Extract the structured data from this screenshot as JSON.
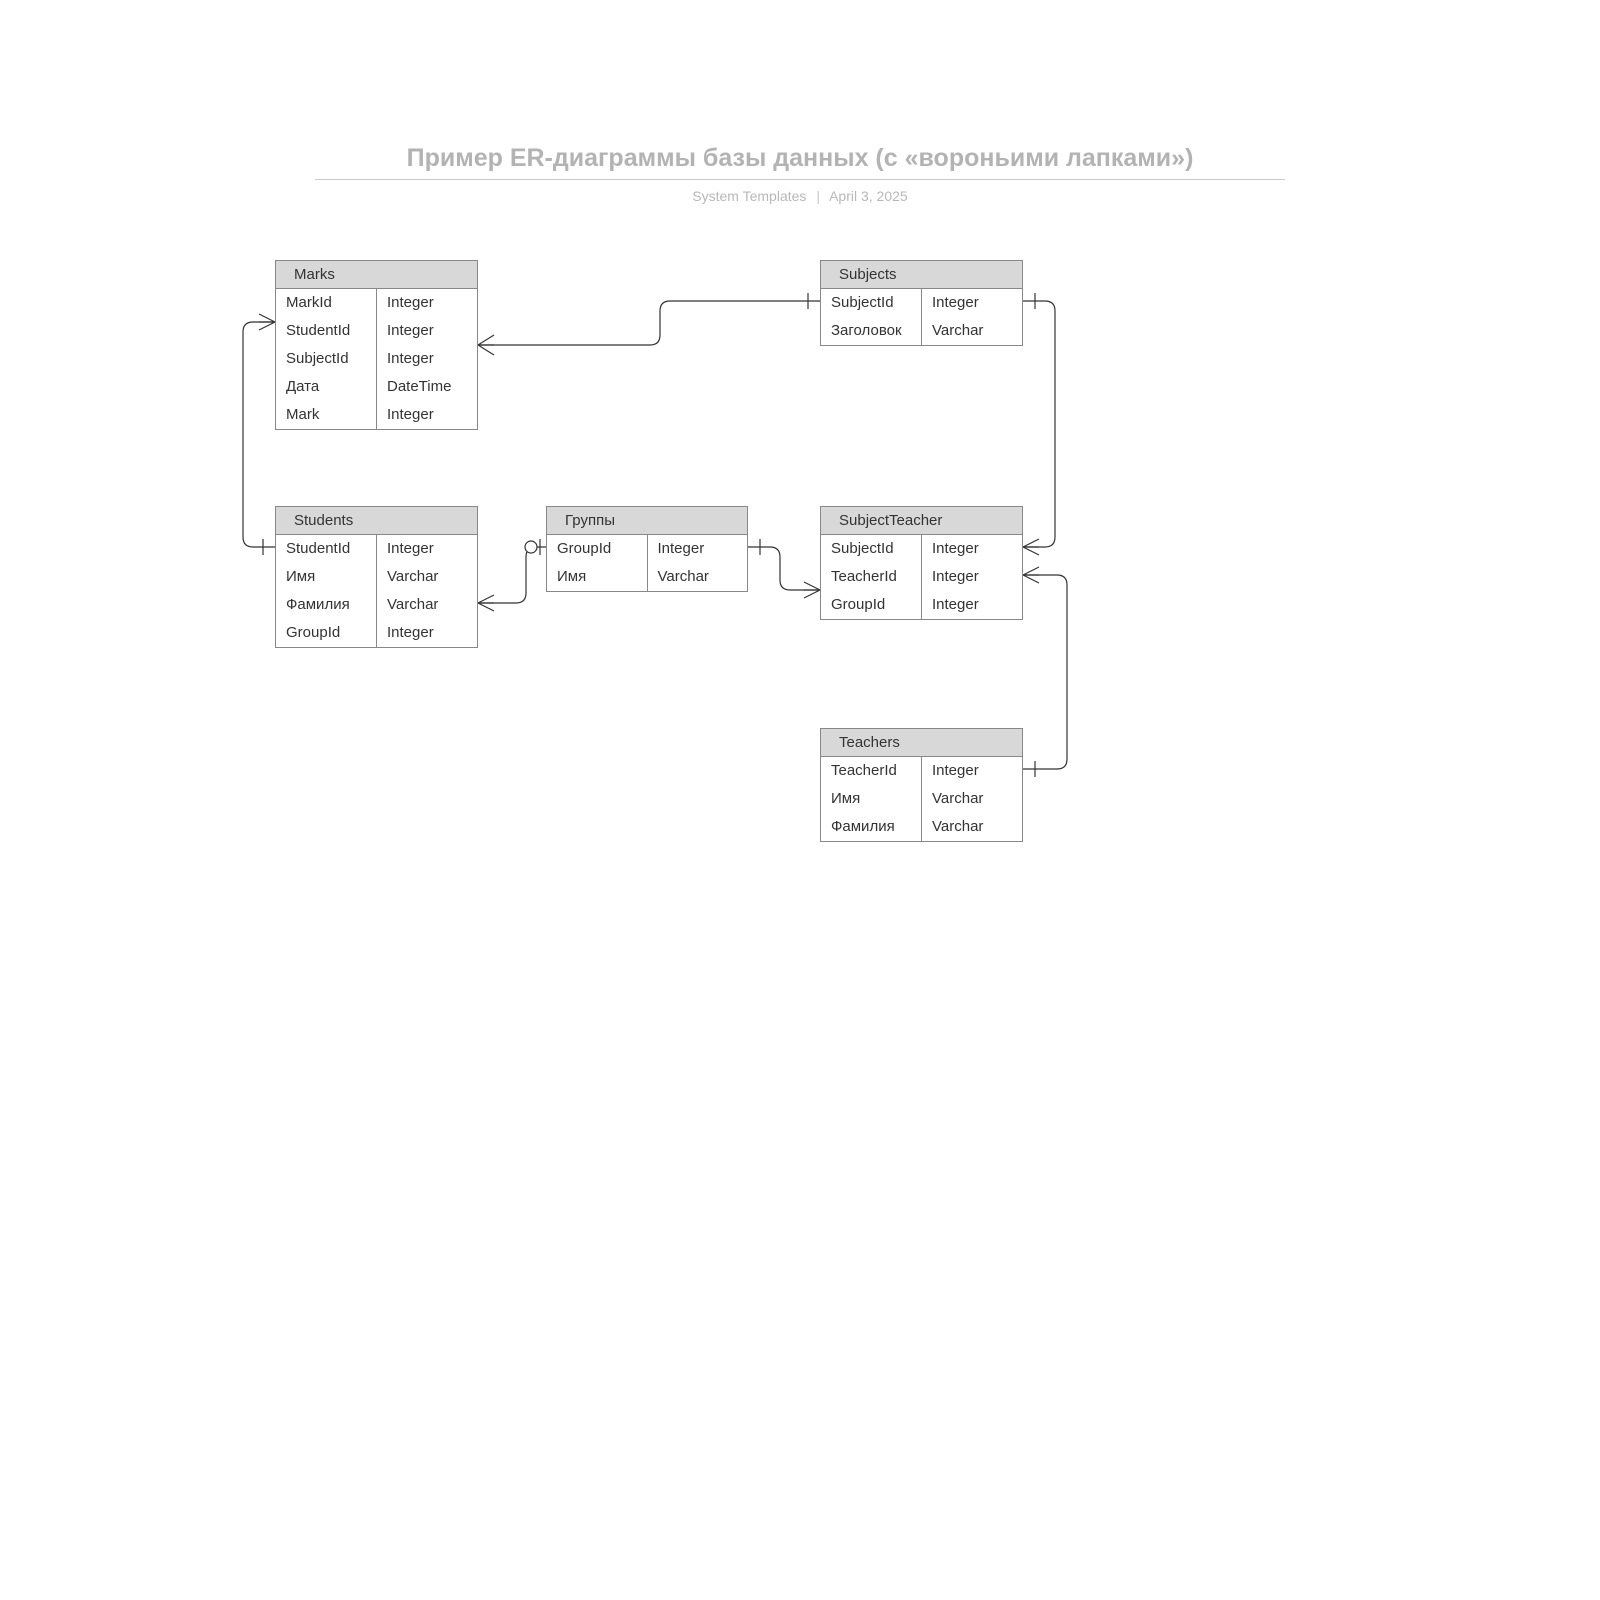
{
  "header": {
    "title": "Пример ER-диаграммы базы данных (с «вороньими лапками»)",
    "author": "System Templates",
    "date": "April 3, 2025"
  },
  "entities": {
    "marks": {
      "name": "Marks",
      "fields": [
        {
          "name": "MarkId",
          "type": "Integer"
        },
        {
          "name": "StudentId",
          "type": "Integer"
        },
        {
          "name": "SubjectId",
          "type": "Integer"
        },
        {
          "name": "Дата",
          "type": "DateTime"
        },
        {
          "name": "Mark",
          "type": "Integer"
        }
      ]
    },
    "subjects": {
      "name": "Subjects",
      "fields": [
        {
          "name": "SubjectId",
          "type": "Integer"
        },
        {
          "name": "Заголовок",
          "type": "Varchar"
        }
      ]
    },
    "students": {
      "name": "Students",
      "fields": [
        {
          "name": "StudentId",
          "type": "Integer"
        },
        {
          "name": "Имя",
          "type": "Varchar"
        },
        {
          "name": "Фамилия",
          "type": "Varchar"
        },
        {
          "name": "GroupId",
          "type": "Integer"
        }
      ]
    },
    "groups": {
      "name": "Группы",
      "fields": [
        {
          "name": "GroupId",
          "type": "Integer"
        },
        {
          "name": "Имя",
          "type": "Varchar"
        }
      ]
    },
    "subjectTeacher": {
      "name": "SubjectTeacher",
      "fields": [
        {
          "name": "SubjectId",
          "type": "Integer"
        },
        {
          "name": "TeacherId",
          "type": "Integer"
        },
        {
          "name": "GroupId",
          "type": "Integer"
        }
      ]
    },
    "teachers": {
      "name": "Teachers",
      "fields": [
        {
          "name": "TeacherId",
          "type": "Integer"
        },
        {
          "name": "Имя",
          "type": "Varchar"
        },
        {
          "name": "Фамилия",
          "type": "Varchar"
        }
      ]
    }
  },
  "relationships": [
    {
      "from": "Marks",
      "to": "Subjects",
      "fromCard": "many",
      "toCard": "one"
    },
    {
      "from": "Marks",
      "to": "Students",
      "fromCard": "many",
      "toCard": "one"
    },
    {
      "from": "Students",
      "to": "Группы",
      "fromCard": "many-optional",
      "toCard": "one"
    },
    {
      "from": "SubjectTeacher",
      "to": "Группы",
      "fromCard": "many",
      "toCard": "one"
    },
    {
      "from": "SubjectTeacher",
      "to": "Subjects",
      "fromCard": "many",
      "toCard": "one"
    },
    {
      "from": "SubjectTeacher",
      "to": "Teachers",
      "fromCard": "many",
      "toCard": "one"
    }
  ]
}
